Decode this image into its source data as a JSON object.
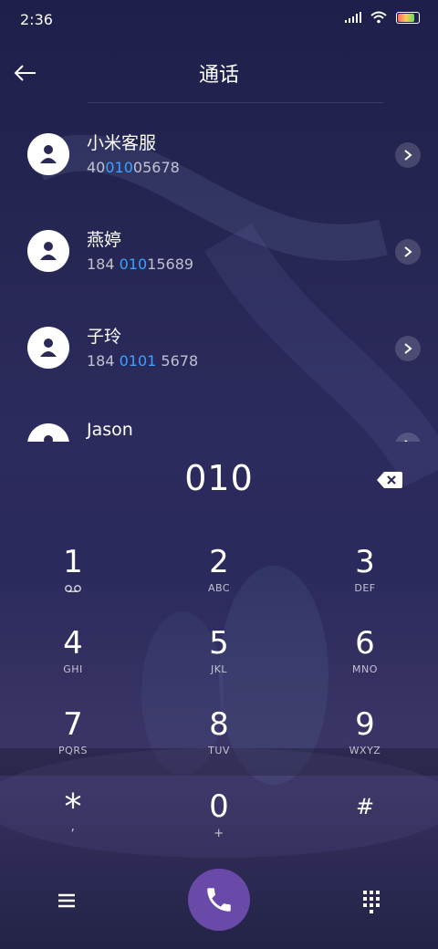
{
  "status": {
    "time": "2:36"
  },
  "header": {
    "title": "通话"
  },
  "contacts": [
    {
      "name": "小米客服",
      "num_pre": "40",
      "num_hl": "010",
      "num_post": "05678"
    },
    {
      "name": "燕婷",
      "num_pre": "184 ",
      "num_hl": "010",
      "num_post": "15689"
    },
    {
      "name": "子玲",
      "num_pre": "184 ",
      "num_hl": "0101",
      "num_post": " 5678"
    },
    {
      "name": "Jason",
      "num_pre": "",
      "num_hl": "",
      "num_post": ""
    }
  ],
  "dialer": {
    "input": "010",
    "keys": [
      {
        "digit": "1",
        "sub": ""
      },
      {
        "digit": "2",
        "sub": "ABC"
      },
      {
        "digit": "3",
        "sub": "DEF"
      },
      {
        "digit": "4",
        "sub": "GHI"
      },
      {
        "digit": "5",
        "sub": "JKL"
      },
      {
        "digit": "6",
        "sub": "MNO"
      },
      {
        "digit": "7",
        "sub": "PQRS"
      },
      {
        "digit": "8",
        "sub": "TUV"
      },
      {
        "digit": "9",
        "sub": "WXYZ"
      },
      {
        "digit": "*",
        "sub": ","
      },
      {
        "digit": "0",
        "sub": "+"
      },
      {
        "digit": "#",
        "sub": ""
      }
    ]
  },
  "icons": {
    "back": "arrow-left-icon",
    "backspace": "backspace-icon",
    "call": "phone-icon",
    "menu": "menu-icon",
    "grid": "dialpad-icon",
    "voicemail": "voicemail-icon"
  },
  "colors": {
    "highlight": "#3aa3ff",
    "call_button": "#6a4aa8"
  }
}
